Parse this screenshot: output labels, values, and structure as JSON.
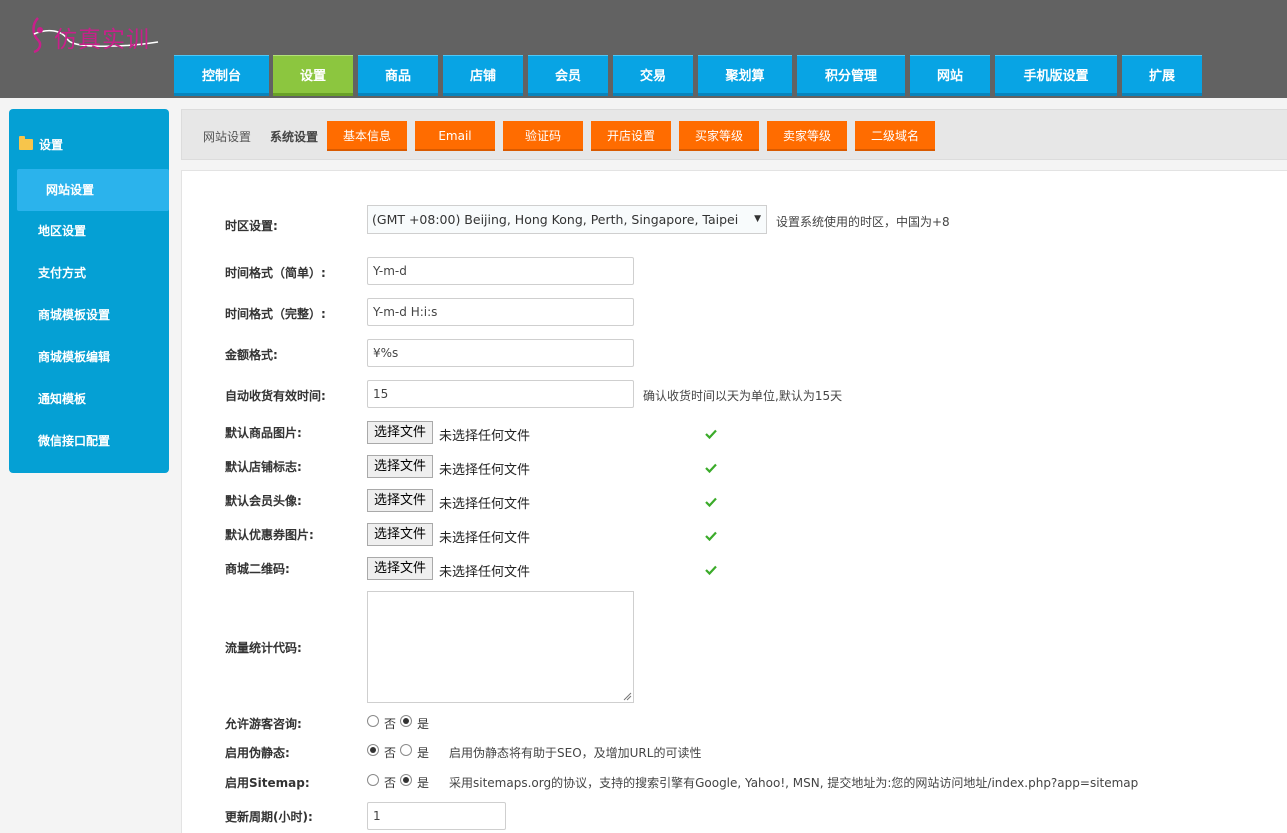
{
  "logo": {
    "text": "仿真实训"
  },
  "topnav": [
    "控制台",
    "设置",
    "商品",
    "店铺",
    "会员",
    "交易",
    "聚划算",
    "积分管理",
    "网站",
    "手机版设置",
    "扩展"
  ],
  "topnav_active": "设置",
  "sidebar": {
    "title": "设置",
    "items": [
      "网站设置",
      "地区设置",
      "支付方式",
      "商城模板设置",
      "商城模板编辑",
      "通知模板",
      "微信接口配置"
    ]
  },
  "subnav": {
    "crumb1": "网站设置",
    "crumb2": "系统设置",
    "tabs": [
      "基本信息",
      "Email",
      "验证码",
      "开店设置",
      "买家等级",
      "卖家等级",
      "二级域名"
    ]
  },
  "form": {
    "timezone": {
      "label": "时区设置:",
      "value": "(GMT +08:00) Beijing, Hong Kong, Perth, Singapore, Taipei",
      "hint": "设置系统使用的时区，中国为+8"
    },
    "date_simple": {
      "label": "时间格式（简单）:",
      "value": "Y-m-d"
    },
    "date_full": {
      "label": "时间格式（完整）:",
      "value": "Y-m-d H:i:s"
    },
    "money": {
      "label": "金额格式:",
      "value": "¥%s"
    },
    "auto_receive": {
      "label": "自动收货有效时间:",
      "value": "15",
      "hint": "确认收货时间以天为单位,默认为15天"
    },
    "file_button": "选择文件",
    "file_none": "未选择任何文件",
    "files": [
      {
        "label": "默认商品图片:"
      },
      {
        "label": "默认店铺标志:"
      },
      {
        "label": "默认会员头像:"
      },
      {
        "label": "默认优惠券图片:"
      },
      {
        "label": "商城二维码:"
      }
    ],
    "stats_code": {
      "label": "流量统计代码:"
    },
    "no_label": "否",
    "yes_label": "是",
    "guest": {
      "label": "允许游客咨询:",
      "value": "是"
    },
    "rewrite": {
      "label": "启用伪静态:",
      "value": "否",
      "hint": "启用伪静态将有助于SEO，及增加URL的可读性"
    },
    "sitemap": {
      "label": "启用Sitemap:",
      "value": "是",
      "hint": "采用sitemaps.org的协议，支持的搜索引擎有Google, Yahoo!, MSN, 提交地址为:您的网站访问地址/index.php?app=sitemap"
    },
    "update_cycle": {
      "label": "更新周期(小时):",
      "value": "1"
    }
  },
  "colors": {
    "nav_blue": "#08a4e4",
    "nav_active": "#8cc63f",
    "subtab_orange": "#ff6c00",
    "sidebar_blue": "#05a0d4",
    "check_green": "#3bab2a"
  }
}
